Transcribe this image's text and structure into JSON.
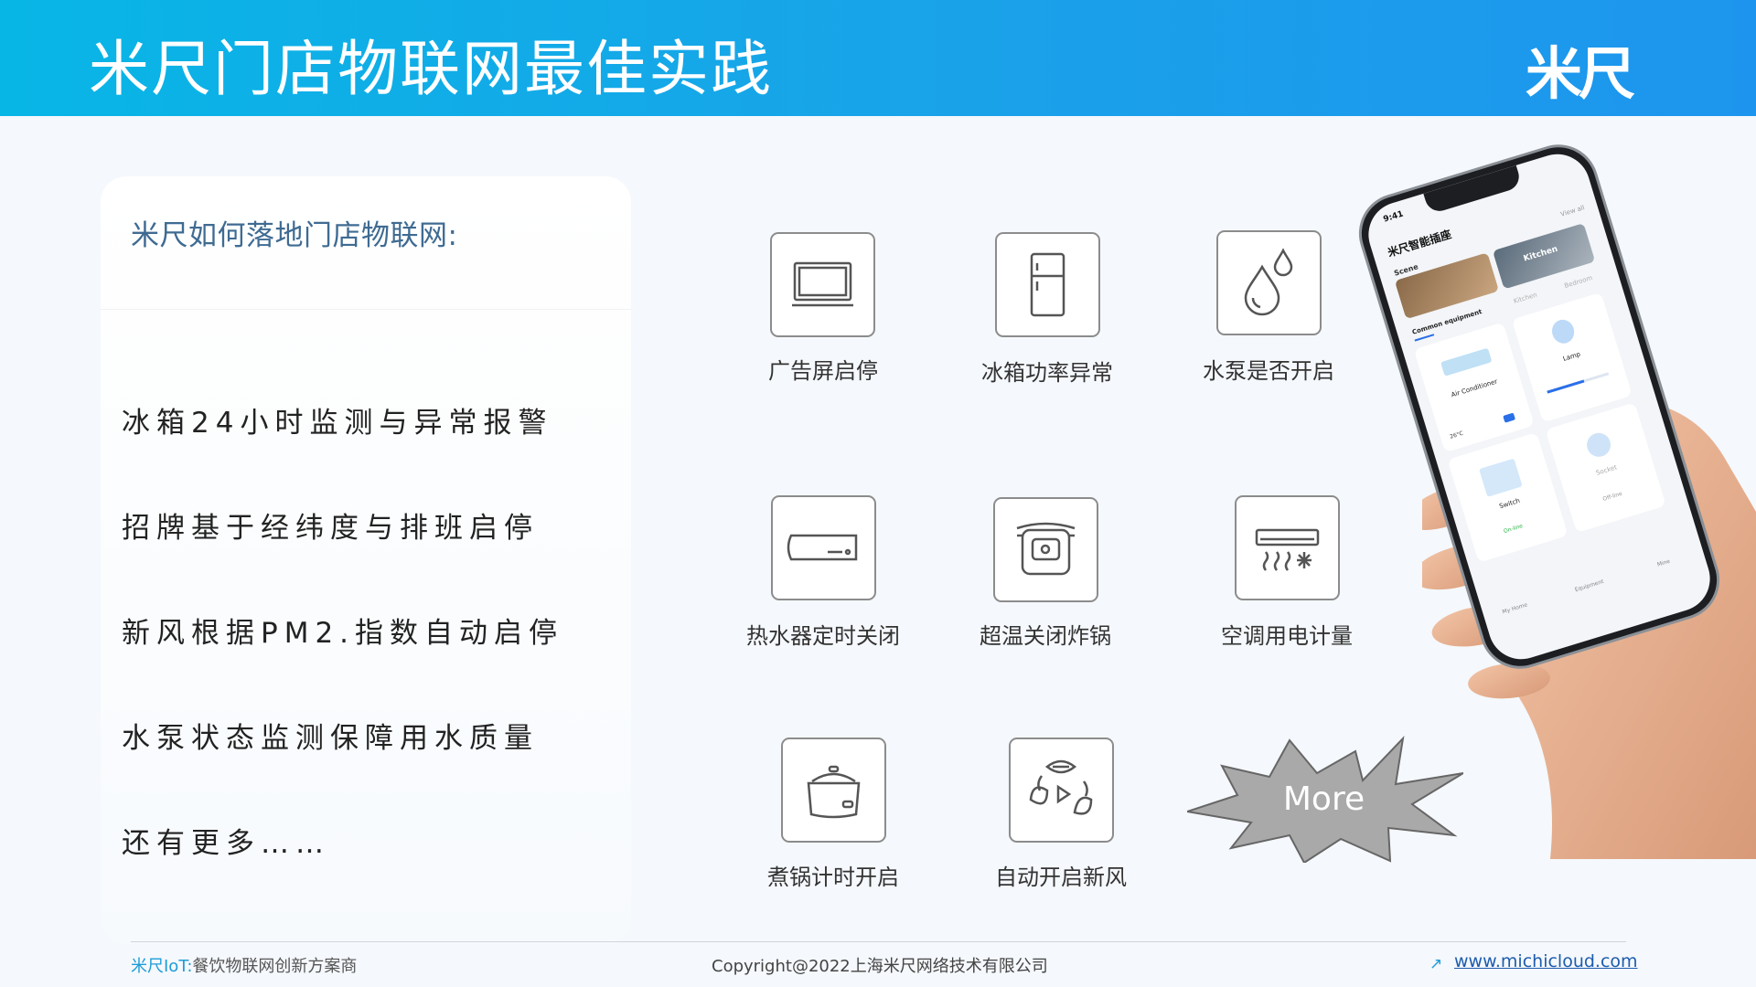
{
  "header": {
    "title": "米尺门店物联网最佳实践",
    "logo_text": "米尺"
  },
  "card": {
    "title": "米尺如何落地门店物联网:",
    "points": [
      "冰箱24小时监测与异常报警",
      "招牌基于经纬度与排班启停",
      "新风根据PM2.指数自动启停",
      "水泵状态监测保障用水质量",
      "还有更多……"
    ]
  },
  "tiles": [
    {
      "label": "广告屏启停",
      "icon": "monitor-icon"
    },
    {
      "label": "冰箱功率异常",
      "icon": "fridge-icon"
    },
    {
      "label": "水泵是否开启",
      "icon": "water-drops-icon"
    },
    {
      "label": "热水器定时关闭",
      "icon": "water-heater-icon"
    },
    {
      "label": "超温关闭炸锅",
      "icon": "fryer-icon"
    },
    {
      "label": "空调用电计量",
      "icon": "air-conditioner-icon"
    },
    {
      "label": "煮锅计时开启",
      "icon": "rice-cooker-icon"
    },
    {
      "label": "自动开启新风",
      "icon": "fresh-air-icon"
    }
  ],
  "more_label": "More",
  "phone": {
    "time": "9:41",
    "title": "米尺智能插座",
    "view_all": "View all",
    "scene_label": "Scene",
    "scenes": [
      "Kitchen"
    ],
    "tabs": [
      "Common equipment",
      "Kitchen",
      "Bedroom"
    ],
    "devices": [
      {
        "name": "Air Conditioner",
        "detail": "26°C"
      },
      {
        "name": "Lamp",
        "detail": ""
      },
      {
        "name": "Switch",
        "detail": "On-line"
      },
      {
        "name": "Socket",
        "detail": "Off-line"
      }
    ],
    "nav": [
      "My Home",
      "Equipment",
      "Mine"
    ]
  },
  "footer": {
    "brand": "米尺IoT:",
    "tagline": "餐饮物联网创新方案商",
    "copyright": "Copyright@2022上海米尺网络技术有限公司",
    "link": "www.michicloud.com"
  },
  "colors": {
    "header_start": "#08b6e6",
    "header_end": "#1d95ee",
    "card_title": "#3f6b92",
    "link": "#1d5cad"
  }
}
